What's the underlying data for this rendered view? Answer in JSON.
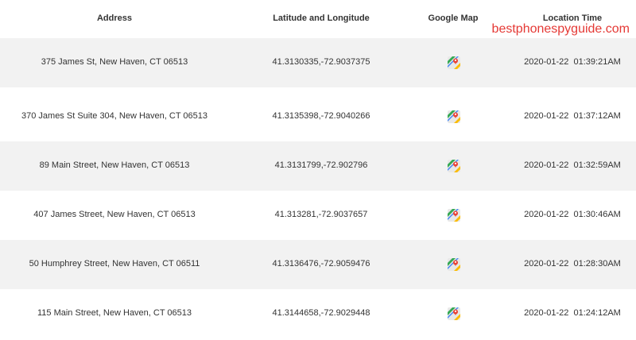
{
  "header": {
    "address": "Address",
    "latlng": "Latitude and Longitude",
    "map": "Google Map",
    "time": "Location Time"
  },
  "watermark": "bestphonespyguide.com",
  "rows": [
    {
      "address": "375 James St, New Haven, CT 06513",
      "latlng": "41.3130335,-72.9037375",
      "map_icon": "google-maps-icon",
      "time": "2020-01-22  01:39:21AM"
    },
    {
      "address": "370 James St Suite 304, New Haven, CT 06513",
      "latlng": "41.3135398,-72.9040266",
      "map_icon": "google-maps-icon",
      "time": "2020-01-22  01:37:12AM"
    },
    {
      "address": "89 Main Street, New Haven, CT 06513",
      "latlng": "41.3131799,-72.902796",
      "map_icon": "google-maps-icon",
      "time": "2020-01-22  01:32:59AM"
    },
    {
      "address": "407 James Street, New Haven, CT 06513",
      "latlng": "41.313281,-72.9037657",
      "map_icon": "google-maps-icon",
      "time": "2020-01-22  01:30:46AM"
    },
    {
      "address": "50 Humphrey Street, New Haven, CT 06511",
      "latlng": "41.3136476,-72.9059476",
      "map_icon": "google-maps-icon",
      "time": "2020-01-22  01:28:30AM"
    },
    {
      "address": "115 Main Street, New Haven, CT 06513",
      "latlng": "41.3144658,-72.9029448",
      "map_icon": "google-maps-icon",
      "time": "2020-01-22  01:24:12AM"
    }
  ],
  "colors": {
    "watermark": "#e53935",
    "row_shade": "#f2f2f2",
    "text": "#333333"
  }
}
